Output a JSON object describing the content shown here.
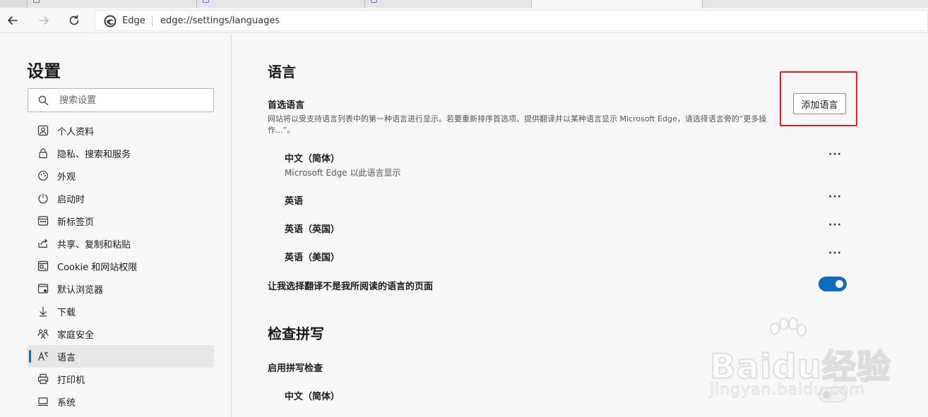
{
  "browser": {
    "brand_label": "Edge",
    "url": "edge://settings/languages",
    "accent": "#0f6cbd"
  },
  "sidebar": {
    "title": "设置",
    "search_placeholder": "搜索设置",
    "items": [
      {
        "label": "个人资料",
        "icon": "profile-icon"
      },
      {
        "label": "隐私、搜索和服务",
        "icon": "lock-icon"
      },
      {
        "label": "外观",
        "icon": "appearance-icon"
      },
      {
        "label": "启动时",
        "icon": "power-icon"
      },
      {
        "label": "新标签页",
        "icon": "new-tab-icon"
      },
      {
        "label": "共享、复制和粘贴",
        "icon": "share-icon"
      },
      {
        "label": "Cookie 和网站权限",
        "icon": "site-permissions-icon"
      },
      {
        "label": "默认浏览器",
        "icon": "browser-icon"
      },
      {
        "label": "下载",
        "icon": "download-icon"
      },
      {
        "label": "家庭安全",
        "icon": "family-icon"
      },
      {
        "label": "语言",
        "icon": "language-icon",
        "active": true
      },
      {
        "label": "打印机",
        "icon": "printer-icon"
      },
      {
        "label": "系统",
        "icon": "system-icon"
      }
    ]
  },
  "main": {
    "language_heading": "语言",
    "preferred_title": "首选语言",
    "preferred_desc": "网站将以受支持语言列表中的第一种语言进行显示。若要重新排序首选项、提供翻译并以某种语言显示 Microsoft Edge，请选择语言旁的“更多操作...”。",
    "add_language_label": "添加语言",
    "languages": [
      {
        "name": "中文（简体）",
        "sub": "Microsoft Edge 以此语言显示"
      },
      {
        "name": "英语",
        "sub": ""
      },
      {
        "name": "英语（英国）",
        "sub": ""
      },
      {
        "name": "英语（美国）",
        "sub": ""
      }
    ],
    "more_label": "···",
    "translate_label": "让我选择翻译不是我所阅读的语言的页面",
    "translate_on": true,
    "spell_heading": "检查拼写",
    "spell_enable_label": "启用拼写检查",
    "spell_language": "中文（简体）",
    "spell_on": false
  },
  "watermark": {
    "brand": "Baidu经验",
    "site": "jingyan.baidu.com"
  }
}
